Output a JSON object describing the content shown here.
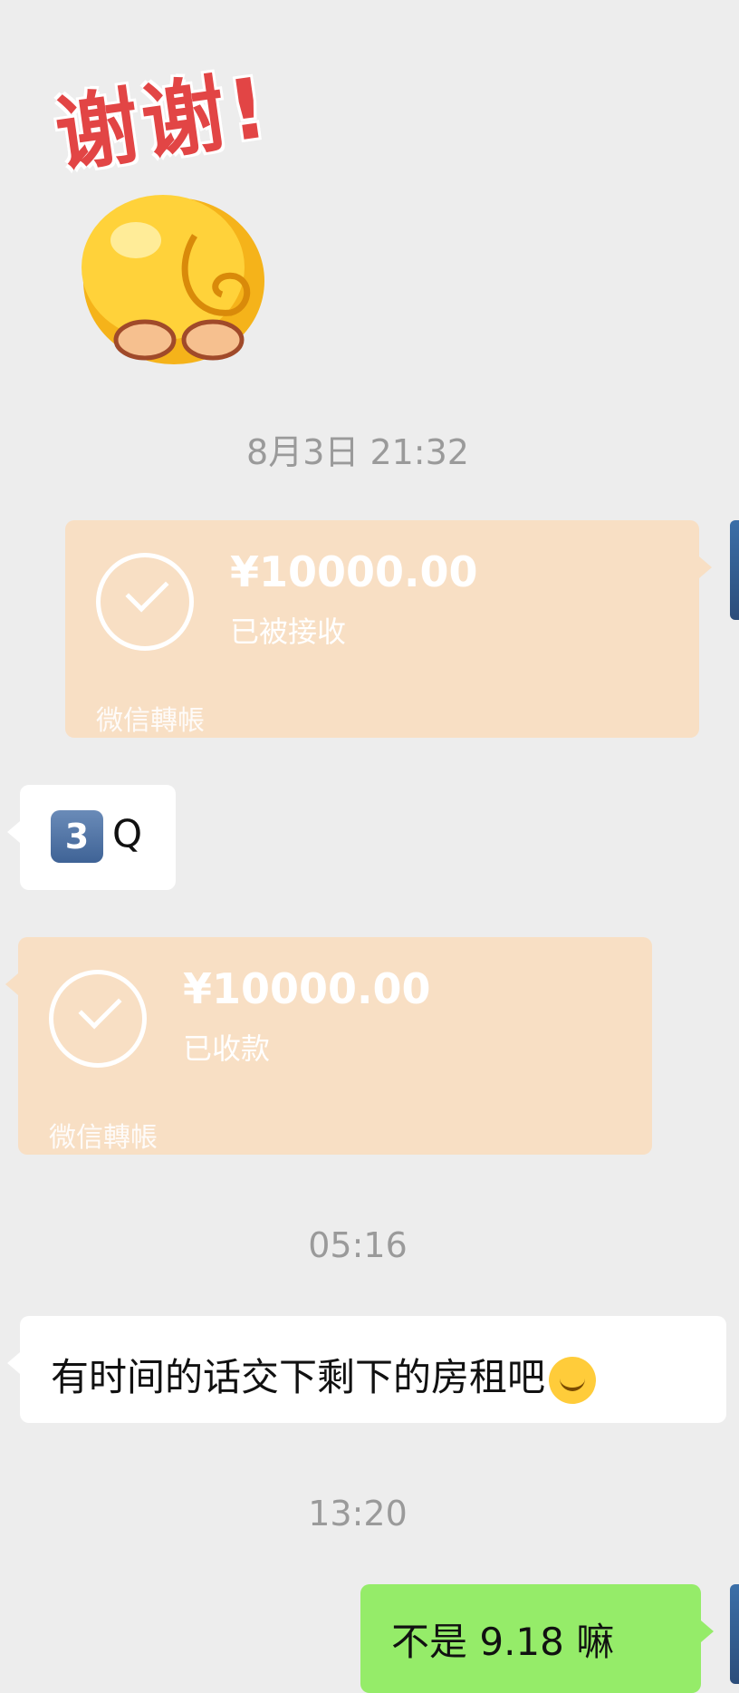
{
  "sticker": {
    "text": "谢谢!"
  },
  "timestamps": {
    "t1": "8月3日 21:32",
    "t2": "05:16",
    "t3": "13:20"
  },
  "transfer_sent": {
    "amount": "¥10000.00",
    "status": "已被接收",
    "label": "微信轉帳"
  },
  "transfer_received": {
    "amount": "¥10000.00",
    "status": "已收款",
    "label": "微信轉帳"
  },
  "messages": {
    "m1_keycap": "3",
    "m1_text": "Q",
    "m2_text": "有时间的话交下剩下的房租吧",
    "m3_text": "不是 9.18 嘛"
  },
  "icons": {
    "sticker": "bowing-emoji-icon",
    "check": "check-circle-icon",
    "smile": "smiling-face-icon",
    "keycap": "keycap-3-icon"
  },
  "colors": {
    "background": "#ededed",
    "transfer_card": "#f8dfc4",
    "sent_bubble": "#95ec69",
    "received_bubble": "#ffffff"
  }
}
